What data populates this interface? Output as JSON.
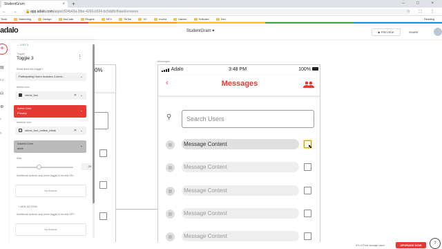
{
  "browser": {
    "tab_title": "StudentGram",
    "tab_close": "×",
    "new_tab": "+",
    "window_controls": "– □ ×",
    "nav_buttons": "← → ⟳",
    "lock_icon": "lock-icon",
    "url_host": "app.adalo.com",
    "url_path": "/apps/cf24b43a-3fbe-4269-b594-bc5dd8cf6aed/screens",
    "url_icons": "☆ ⬚ ⋮",
    "bookmarks": [
      "Tools",
      "Marketing",
      "Design",
      "NoCode",
      "Plugins",
      "NFX",
      "TikTok",
      "VC",
      "Invest",
      "Hazoni",
      "Telecare",
      "Dev"
    ],
    "bookmark_right": "Reading"
  },
  "app": {
    "logo": "adalo",
    "name": "StudentGram ▾",
    "preview_label": "▶ PREVIEW",
    "share_label": "SHARE"
  },
  "toolbar": {
    "add": "+",
    "icons": [
      "layers-icon",
      "screens-icon",
      "database-icon",
      "settings-icon",
      "analytics-icon",
      "code-icon"
    ]
  },
  "panel": {
    "back_label": "← LIST 3",
    "component_type": "Toggle",
    "component_name": "Toggle 3",
    "question_label": "What does this toggle?",
    "question_value": "Participating Users Includes Curren...",
    "active_icon_label": "Active Icon",
    "active_icon_value": "check_box",
    "active_color_label": "Active Color",
    "active_color_value": "Primary",
    "inactive_icon_label": "Inactive Icon",
    "inactive_icon_value": "check_box_outline_blank",
    "inactive_color_label": "Inactive Color",
    "inactive_color_value": "#bbb",
    "size_label": "Size",
    "size_value": "24",
    "size_fraction": 0.4,
    "on_actions_label": "Additional actions only when toggle is turned ON:",
    "no_actions": "No Actions",
    "add_action": "+ ADD ACTION",
    "off_actions_label": "Additional actions only when toggle is turned OFF:"
  },
  "canvas": {
    "left_phone_status": "0%",
    "screen_label": "Messages",
    "carrier": "Adalo",
    "time": "3:48 PM",
    "battery": "100%",
    "title": "Messages",
    "back_icon": "‹",
    "search_placeholder": "Search Users",
    "search_icon": "🔍",
    "messages": [
      "Message Content",
      "Message Content",
      "Message Content",
      "Message Content",
      "Message Content"
    ]
  },
  "footer": {
    "storage": "0% of Free storage used",
    "upgrade": "UPGRADE NOW",
    "help": "?"
  },
  "colors": {
    "accent": "#e53935",
    "active_color_swatch": "#e53935",
    "inactive_color_swatch": "#bbbbbb"
  }
}
